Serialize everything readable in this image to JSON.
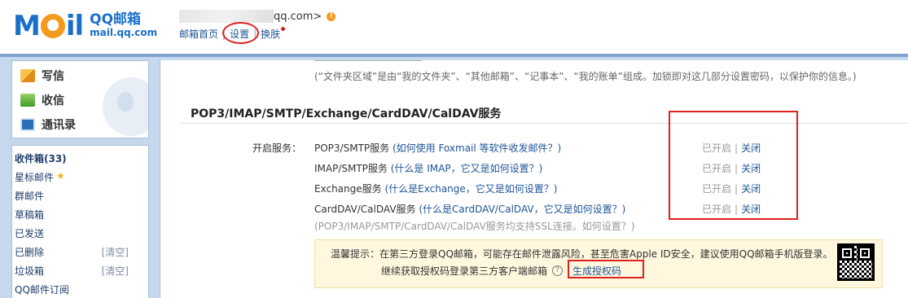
{
  "brand": {
    "logo_mark": "Moil",
    "name_cn": "QQ邮箱",
    "name_en": "mail.qq.com",
    "color": "#1a6fc9"
  },
  "account": {
    "email_suffix": "qq.com>",
    "warning_icon": "exclamation-icon"
  },
  "toplinks": {
    "home": "邮箱首页",
    "settings": "设置",
    "skin": "换肤"
  },
  "sidebar": {
    "compose": "写信",
    "receive": "收信",
    "contacts": "通讯录",
    "folders": [
      {
        "label": "收件箱(33)",
        "action": ""
      },
      {
        "label": "星标邮件",
        "action": ""
      },
      {
        "label": "群邮件",
        "action": ""
      },
      {
        "label": "草稿箱",
        "action": ""
      },
      {
        "label": "已发送",
        "action": ""
      },
      {
        "label": "已删除",
        "action": "[清空]"
      },
      {
        "label": "垃圾箱",
        "action": "[清空]"
      },
      {
        "label": "QQ邮件订阅",
        "action": ""
      }
    ]
  },
  "main": {
    "note": "(“文件夹区域”是由“我的文件夹”、“其他邮箱”、“记事本”、“我的账单”组成。加锁即对这几部分设置密码，以保护你的信息。)",
    "section_title": "POP3/IMAP/SMTP/Exchange/CardDAV/CalDAV服务",
    "service_label": "开启服务：",
    "services": [
      {
        "name": "POP3/SMTP服务",
        "help": "(如何使用 Foxmail 等软件收发邮件？)",
        "status": "已开启",
        "action": "关闭"
      },
      {
        "name": "IMAP/SMTP服务",
        "help": "(什么是 IMAP，它又是如何设置？)",
        "status": "已开启",
        "action": "关闭"
      },
      {
        "name": "Exchange服务",
        "help": "(什么是Exchange，它又是如何设置？)",
        "status": "已开启",
        "action": "关闭"
      },
      {
        "name": "CardDAV/CalDAV服务",
        "help": "(什么是CardDAV/CalDAV，它又是如何设置？)",
        "status": "已开启",
        "action": "关闭"
      }
    ],
    "status_separator": "|",
    "ssl_note_prefix": "(POP3/IMAP/SMTP/CardDAV/CalDAV服务均支持SSL连接。",
    "ssl_note_link": "如何设置？",
    "ssl_note_suffix": ")",
    "tip_line1": "温馨提示：在第三方登录QQ邮箱，可能存在邮件泄露风险，甚至危害Apple ID安全，建议使用QQ邮箱手机版登录。",
    "tip_line2": "继续获取授权码登录第三方客户端邮箱",
    "help_icon": "?",
    "generate_button": "生成授权码"
  },
  "colors": {
    "link": "#1e5494",
    "highlight_red": "#e0201c",
    "frame_blue": "#c5d8ee",
    "tip_bg": "#fff8df"
  }
}
